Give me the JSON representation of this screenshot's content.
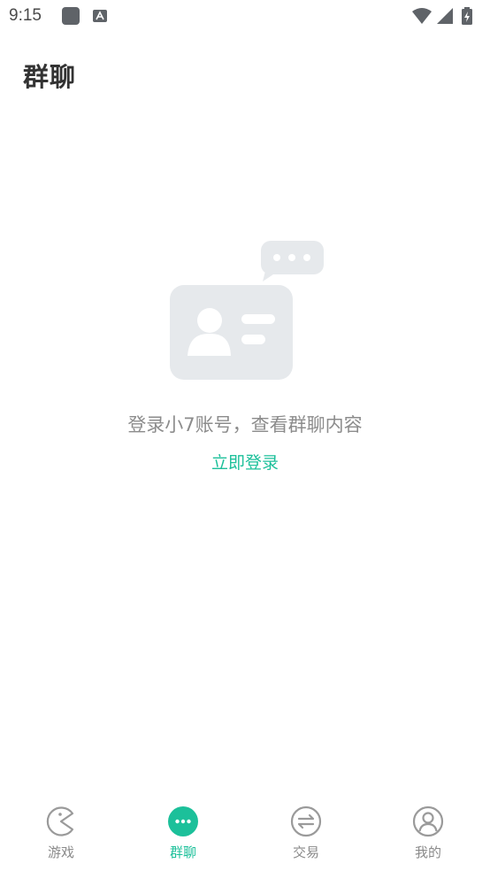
{
  "status_bar": {
    "time": "9:15"
  },
  "header": {
    "title": "群聊"
  },
  "empty_state": {
    "message": "登录小7账号，查看群聊内容",
    "login_label": "立即登录"
  },
  "tabs": [
    {
      "label": "游戏",
      "icon": "pacman-icon",
      "active": false
    },
    {
      "label": "群聊",
      "icon": "chat-bubble-icon",
      "active": true
    },
    {
      "label": "交易",
      "icon": "exchange-icon",
      "active": false
    },
    {
      "label": "我的",
      "icon": "user-icon",
      "active": false
    }
  ],
  "colors": {
    "accent": "#1cc09a",
    "inactive": "#8a8a8a",
    "illustration": "#e6e9ec"
  }
}
